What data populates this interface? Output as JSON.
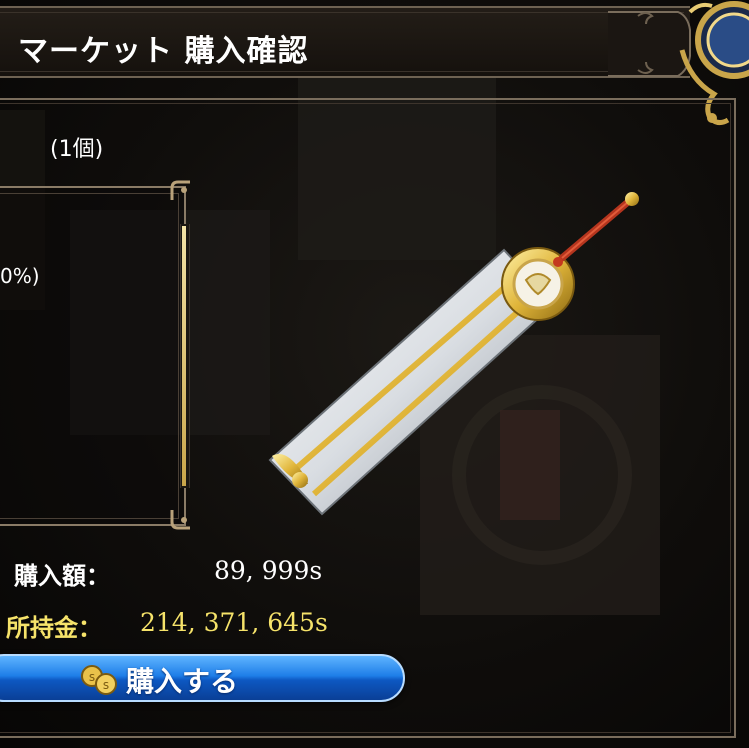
{
  "header": {
    "title": "マーケット 購入確認"
  },
  "item": {
    "quantity": "(1個)",
    "percent_fragment": "0%)",
    "icon": "two-handed-sword-icon"
  },
  "purchase": {
    "price_label": "購入額：",
    "price_value": "89, 999s",
    "funds_label": "所持金：",
    "funds_value": "214, 371, 645s",
    "button_label": "購入する",
    "button_icon": "coins-icon"
  },
  "colors": {
    "funds_text": "#f6e36a",
    "button_blue": "#1e7ee8",
    "frame_gold": "#8a7b66"
  }
}
